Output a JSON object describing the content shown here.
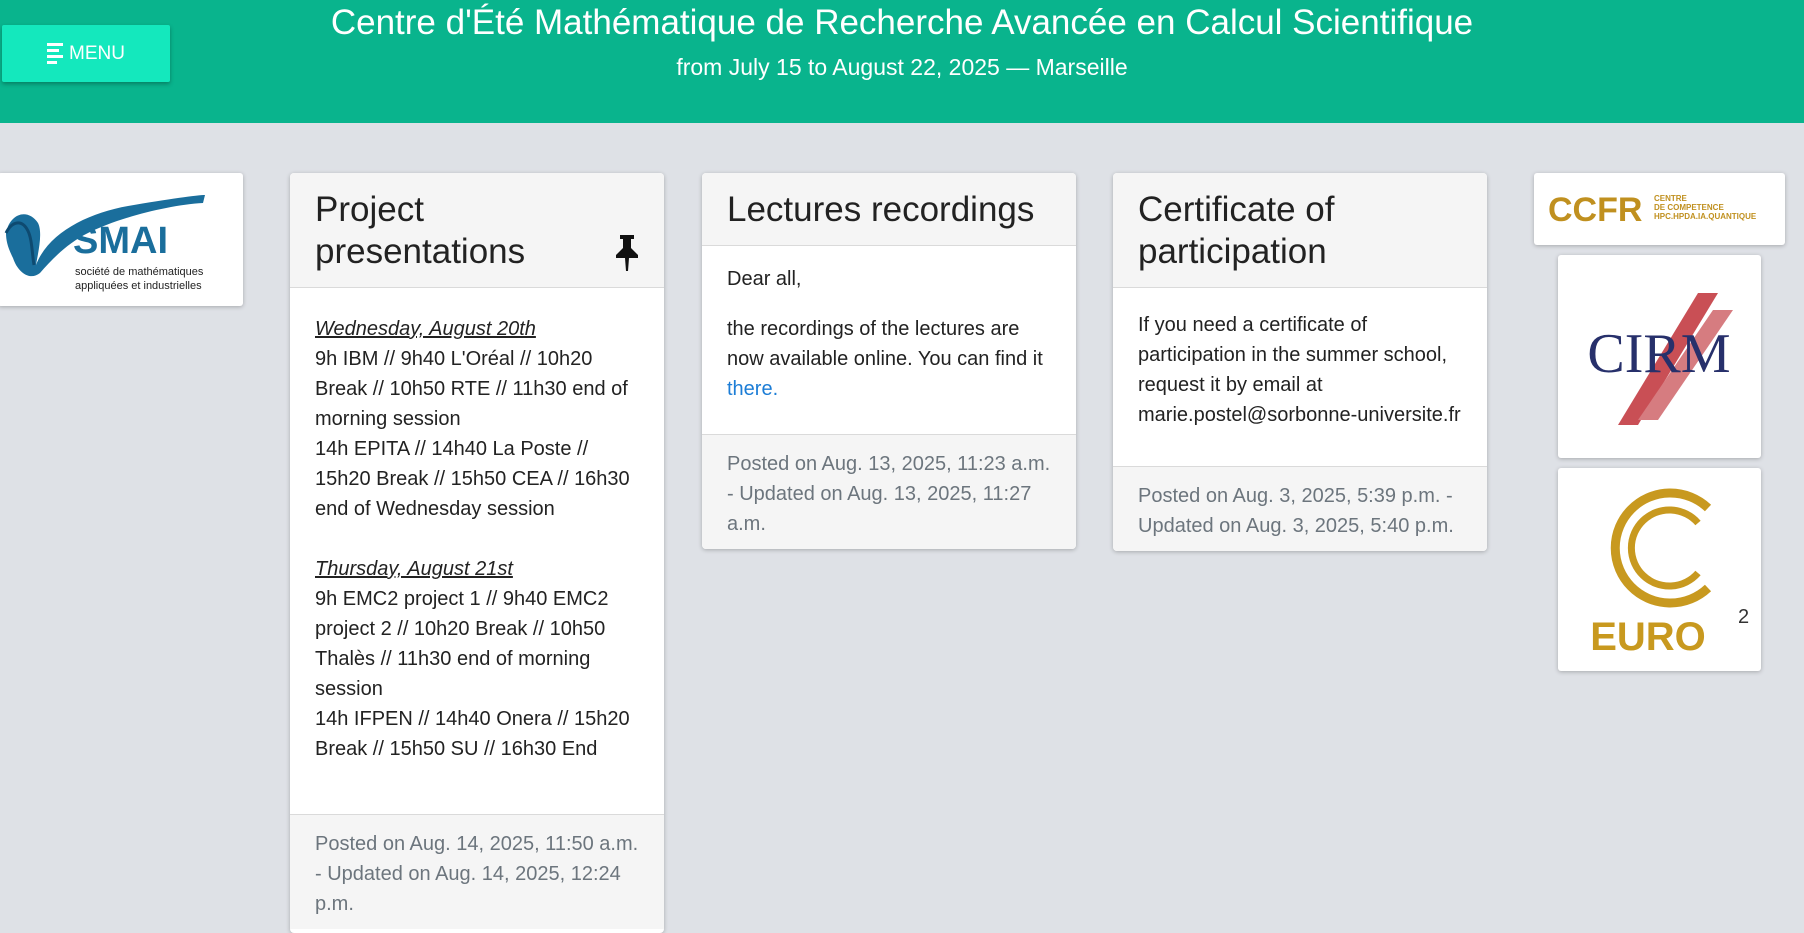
{
  "header": {
    "menu_label": "MENU",
    "title": "Centre d'Été Mathématique de Recherche Avancée en Calcul Scientifique",
    "subtitle": "from July 15 to August 22, 2025 — Marseille"
  },
  "logos": {
    "smai_name": "SMAI",
    "smai_line1": "société de mathématiques",
    "smai_line2": "appliquées et industrielles",
    "ccfr_name": "CCFR",
    "ccfr_line1": "CENTRE",
    "ccfr_line2": "DE COMPETENCE",
    "ccfr_line3": "HPC.HPDA.IA.QUANTIQUE",
    "cirm_name": "CIRM",
    "euro_name": "EURO",
    "euro_sup": "2"
  },
  "cards": [
    {
      "title": "Project presentations",
      "pin_icon": "pin-icon",
      "day1": "Wednesday, August 20th",
      "day1_morning": "9h IBM // 9h40 L'Oréal // 10h20 Break // 10h50 RTE // 11h30 end of morning session",
      "day1_afternoon": "14h EPITA // 14h40 La Poste // 15h20 Break // 15h50 CEA // 16h30 end of Wednesday session",
      "day2": "Thursday, August 21st",
      "day2_morning": "9h EMC2 project 1 // 9h40 EMC2 project 2 // 10h20 Break // 10h50 Thalès // 11h30 end of morning session",
      "day2_afternoon": "14h IFPEN // 14h40 Onera // 15h20 Break // 15h50 SU // 16h30 End",
      "footer": "Posted on Aug. 14, 2025, 11:50 a.m. - Updated on Aug. 14, 2025, 12:24 p.m."
    },
    {
      "title": "Lectures recordings",
      "greeting": "Dear all,",
      "body": "the recordings of the lectures are now available online. You can find it",
      "link": "there.",
      "footer": "Posted on Aug. 13, 2025, 11:23 a.m. - Updated on Aug. 13, 2025, 11:27 a.m."
    },
    {
      "title": "Certificate of participation",
      "body": "If you need a certificate of participation in the summer school, request it by email at marie.postel@sorbonne-universite.fr",
      "footer": "Posted on Aug. 3, 2025, 5:39 p.m. - Updated on Aug. 3, 2025, 5:40 p.m."
    }
  ],
  "colors": {
    "header_bg": "#09b48d",
    "menu_bg": "#14e8bd",
    "link": "#1c7dd6",
    "page_bg": "#dee1e6"
  }
}
